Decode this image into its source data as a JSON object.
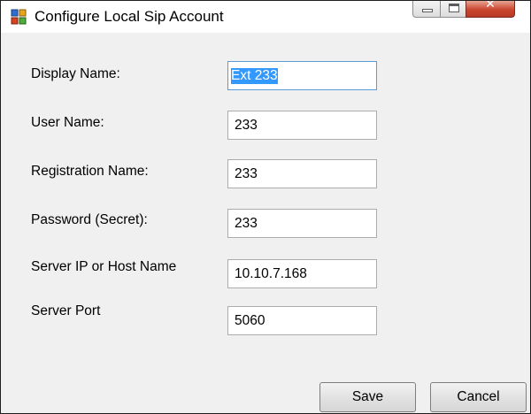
{
  "window": {
    "title": "Configure Local Sip Account",
    "icon": "app-window-icon"
  },
  "form": {
    "fields": [
      {
        "name": "display-name",
        "label": "Display Name:",
        "value": "Ext 233",
        "selected": true
      },
      {
        "name": "user-name",
        "label": "User Name:",
        "value": "233"
      },
      {
        "name": "registration-name",
        "label": "Registration Name:",
        "value": "233"
      },
      {
        "name": "password",
        "label": "Password (Secret):",
        "value": "233"
      },
      {
        "name": "server-host",
        "label": "Server IP or Host Name",
        "value": "10.10.7.168"
      },
      {
        "name": "server-port",
        "label": "Server Port",
        "value": "5060"
      }
    ]
  },
  "buttons": {
    "save": "Save",
    "cancel": "Cancel"
  },
  "colors": {
    "window_background": "#f0f0f0",
    "selection_highlight": "#3399ff",
    "close_button": "#c9462f"
  }
}
